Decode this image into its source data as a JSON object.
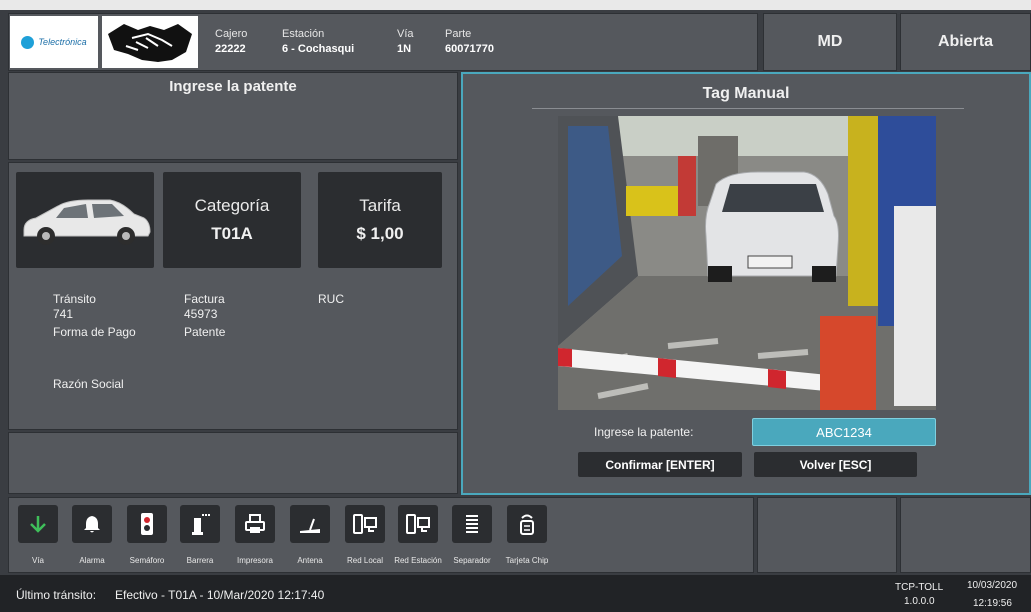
{
  "header": {
    "brand": "Telectrónica",
    "cajero": {
      "label": "Cajero",
      "value": "22222"
    },
    "estacion": {
      "label": "Estación",
      "value": "6 - Cochasqui"
    },
    "via": {
      "label": "Vía",
      "value": "1N"
    },
    "parte": {
      "label": "Parte",
      "value": "60071770"
    },
    "mode": "MD",
    "status": "Abierta"
  },
  "left": {
    "title": "Ingrese la patente",
    "categoria": {
      "label": "Categoría",
      "value": "T01A"
    },
    "tarifa": {
      "label": "Tarifa",
      "value": "$ 1,00"
    },
    "transito": {
      "label": "Tránsito",
      "value": "741"
    },
    "factura": {
      "label": "Factura",
      "value": "45973"
    },
    "ruc": {
      "label": "RUC"
    },
    "forma_pago": {
      "label": "Forma de Pago"
    },
    "patente": {
      "label": "Patente"
    },
    "razon_social": {
      "label": "Razón Social"
    }
  },
  "tag_manual": {
    "title": "Tag Manual",
    "plate_label": "Ingrese la patente:",
    "plate_value": "ABC1234",
    "confirm": "Confirmar [ENTER]",
    "back": "Volver [ESC]"
  },
  "toolbar": [
    {
      "label": "Vía",
      "icon": "arrow-down-icon"
    },
    {
      "label": "Alarma",
      "icon": "bell-icon"
    },
    {
      "label": "Semáforo",
      "icon": "traffic-light-icon"
    },
    {
      "label": "Barrera",
      "icon": "barrier-icon"
    },
    {
      "label": "Impresora",
      "icon": "printer-icon"
    },
    {
      "label": "Antena",
      "icon": "antenna-icon"
    },
    {
      "label": "Red Local",
      "icon": "network-icon"
    },
    {
      "label": "Red Estación",
      "icon": "network-icon"
    },
    {
      "label": "Separador",
      "icon": "separator-icon"
    },
    {
      "label": "Tarjeta Chip",
      "icon": "chip-card-icon"
    }
  ],
  "footer": {
    "last_label": "Último tránsito:",
    "last_value": "Efectivo - T01A - 10/Mar/2020 12:17:40",
    "app": "TCP-TOLL",
    "version": "1.0.0.0",
    "date": "10/03/2020",
    "time": "12:19:56"
  },
  "colors": {
    "accent": "#4aa8bd",
    "green": "#3fbf5a",
    "panel": "#55585d",
    "dark": "#2b2d30"
  }
}
